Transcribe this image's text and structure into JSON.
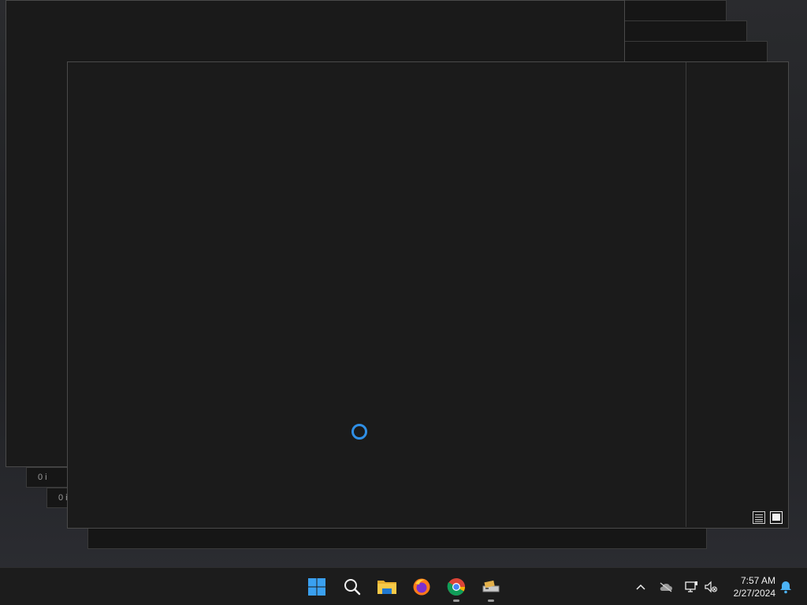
{
  "background_windows": {
    "status_text_1": "0 i",
    "status_text_2": "0 i"
  },
  "taskbar": {
    "apps": [
      {
        "name": "Start",
        "icon": "windows-start-icon"
      },
      {
        "name": "Search",
        "icon": "search-icon"
      },
      {
        "name": "File Explorer",
        "icon": "file-explorer-icon"
      },
      {
        "name": "Firefox",
        "icon": "firefox-icon"
      },
      {
        "name": "Google Chrome",
        "icon": "chrome-icon"
      },
      {
        "name": "Drive utility",
        "icon": "drive-utility-icon"
      }
    ],
    "clock": {
      "time": "7:57 AM",
      "date": "2/27/2024"
    }
  },
  "colors": {
    "spinner": "#2f8fe6",
    "taskbar": "#1c1c1c",
    "window": "#1b1b1b"
  }
}
